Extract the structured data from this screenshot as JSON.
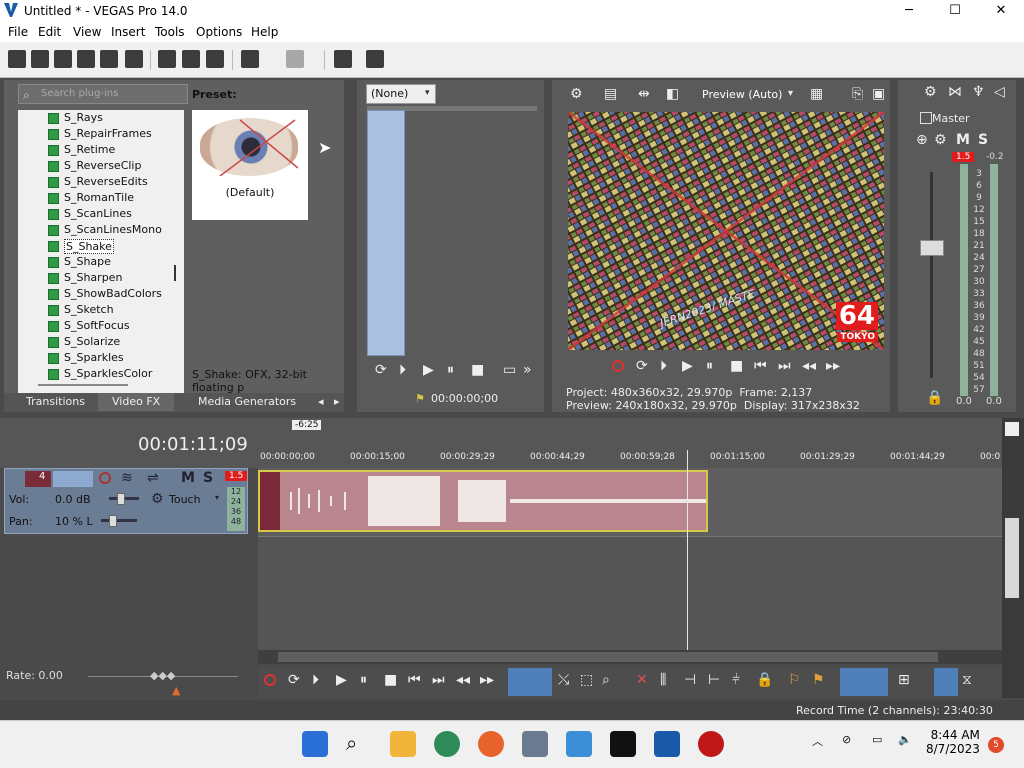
{
  "window": {
    "title": "Untitled * - VEGAS Pro 14.0",
    "min": "─",
    "max": "☐",
    "close": "✕"
  },
  "menu": [
    "File",
    "Edit",
    "View",
    "Insert",
    "Tools",
    "Options",
    "Help"
  ],
  "plugins": {
    "search_placeholder": "Search plug-ins",
    "items": [
      "S_Rays",
      "S_RepairFrames",
      "S_Retime",
      "S_ReverseClip",
      "S_ReverseEdits",
      "S_RomanTile",
      "S_ScanLines",
      "S_ScanLinesMono",
      "S_Shake",
      "S_Shape",
      "S_Sharpen",
      "S_ShowBadColors",
      "S_Sketch",
      "S_SoftFocus",
      "S_Solarize",
      "S_Sparkles",
      "S_SparklesColor"
    ],
    "selected": "S_Shake",
    "preset_label": "Preset:",
    "preset_default": "(Default)",
    "description": "S_Shake: OFX, 32-bit floating p",
    "tabs": [
      "Transitions",
      "Video FX",
      "Media Generators"
    ],
    "active_tab": "Video FX"
  },
  "trimmer": {
    "selector": "(None)",
    "time": "00:00:00;00"
  },
  "preview": {
    "mode": "Preview (Auto)",
    "number_overlay": "64",
    "city_overlay": "TOKYO",
    "text_overlay": "JERN2023/ MASTE",
    "project_label": "Project:",
    "project_value": "480x360x32, 29.970p",
    "frame_label": "Frame:",
    "frame_value": "2,137",
    "preview_label": "Preview:",
    "preview_value": "240x180x32, 29.970p",
    "display_label": "Display:",
    "display_value": "317x238x32"
  },
  "master": {
    "title": "Master",
    "peak_left": "1.5",
    "peak_right": "-0.2",
    "scale": [
      "3",
      "6",
      "9",
      "12",
      "15",
      "18",
      "21",
      "24",
      "27",
      "30",
      "33",
      "36",
      "39",
      "42",
      "45",
      "48",
      "51",
      "54",
      "57"
    ],
    "level_left": "0.0",
    "level_right": "0.0"
  },
  "timeline": {
    "timecode": "00:01:11;09",
    "marker": "-6:25",
    "ticks": [
      "00:00:00;00",
      "00:00:15;00",
      "00:00:29;29",
      "00:00:44;29",
      "00:00:59;28",
      "00:01:15;00",
      "00:01:29;29",
      "00:01:44;29",
      "00:0"
    ],
    "track": {
      "number": "4",
      "vol_label": "Vol:",
      "vol_value": "0.0 dB",
      "pan_label": "Pan:",
      "pan_value": "10 % L",
      "touch": "Touch",
      "peak": "1.5",
      "meter_scale": [
        "12",
        "24",
        "36",
        "48"
      ]
    },
    "rate": "Rate: 0.00",
    "record_time": "Record Time (2 channels): 23:40:30"
  },
  "taskbar": {
    "time": "8:44 AM",
    "date": "8/7/2023",
    "badge": "5"
  }
}
